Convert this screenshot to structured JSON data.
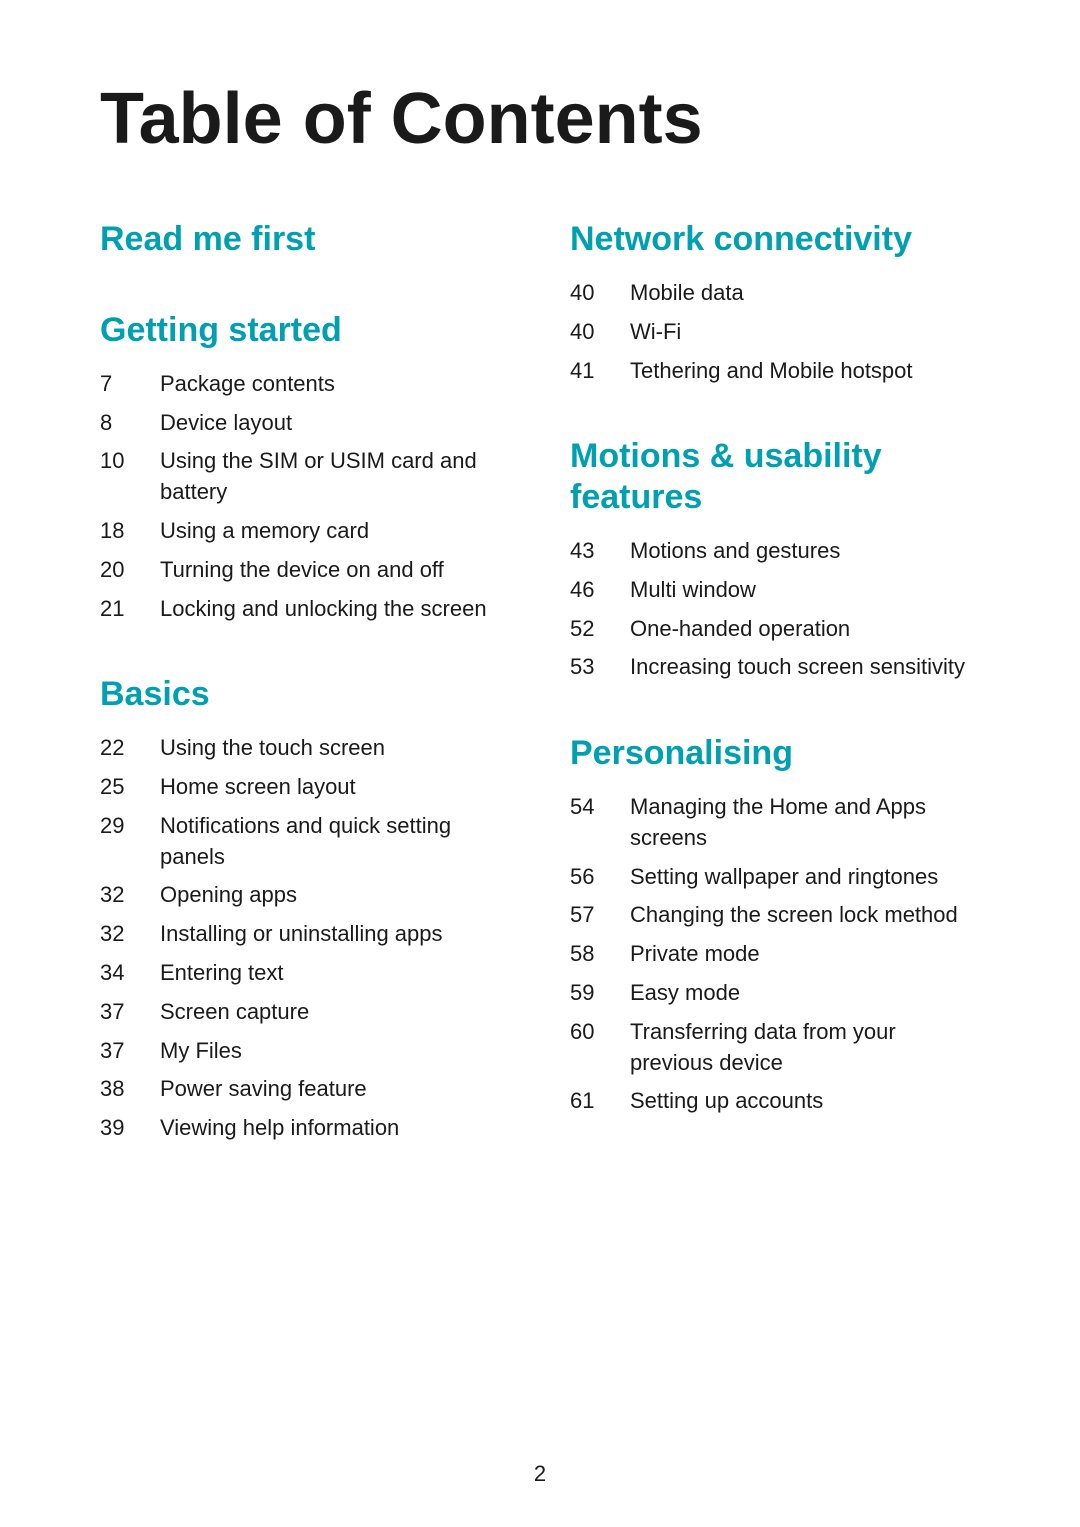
{
  "title": "Table of Contents",
  "pageNumber": "2",
  "leftColumn": {
    "sections": [
      {
        "id": "read-me-first",
        "title": "Read me first",
        "items": []
      },
      {
        "id": "getting-started",
        "title": "Getting started",
        "items": [
          {
            "number": "7",
            "text": "Package contents"
          },
          {
            "number": "8",
            "text": "Device layout"
          },
          {
            "number": "10",
            "text": "Using the SIM or USIM card and battery"
          },
          {
            "number": "18",
            "text": "Using a memory card"
          },
          {
            "number": "20",
            "text": "Turning the device on and off"
          },
          {
            "number": "21",
            "text": "Locking and unlocking the screen"
          }
        ]
      },
      {
        "id": "basics",
        "title": "Basics",
        "items": [
          {
            "number": "22",
            "text": "Using the touch screen"
          },
          {
            "number": "25",
            "text": "Home screen layout"
          },
          {
            "number": "29",
            "text": "Notifications and quick setting panels"
          },
          {
            "number": "32",
            "text": "Opening apps"
          },
          {
            "number": "32",
            "text": "Installing or uninstalling apps"
          },
          {
            "number": "34",
            "text": "Entering text"
          },
          {
            "number": "37",
            "text": "Screen capture"
          },
          {
            "number": "37",
            "text": "My Files"
          },
          {
            "number": "38",
            "text": "Power saving feature"
          },
          {
            "number": "39",
            "text": "Viewing help information"
          }
        ]
      }
    ]
  },
  "rightColumn": {
    "sections": [
      {
        "id": "network-connectivity",
        "title": "Network connectivity",
        "items": [
          {
            "number": "40",
            "text": "Mobile data"
          },
          {
            "number": "40",
            "text": "Wi-Fi"
          },
          {
            "number": "41",
            "text": "Tethering and Mobile hotspot"
          }
        ]
      },
      {
        "id": "motions-usability",
        "title": "Motions & usability features",
        "items": [
          {
            "number": "43",
            "text": "Motions and gestures"
          },
          {
            "number": "46",
            "text": "Multi window"
          },
          {
            "number": "52",
            "text": "One-handed operation"
          },
          {
            "number": "53",
            "text": "Increasing touch screen sensitivity"
          }
        ]
      },
      {
        "id": "personalising",
        "title": "Personalising",
        "items": [
          {
            "number": "54",
            "text": "Managing the Home and Apps screens"
          },
          {
            "number": "56",
            "text": "Setting wallpaper and ringtones"
          },
          {
            "number": "57",
            "text": "Changing the screen lock method"
          },
          {
            "number": "58",
            "text": "Private mode"
          },
          {
            "number": "59",
            "text": "Easy mode"
          },
          {
            "number": "60",
            "text": "Transferring data from your previous device"
          },
          {
            "number": "61",
            "text": "Setting up accounts"
          }
        ]
      }
    ]
  }
}
